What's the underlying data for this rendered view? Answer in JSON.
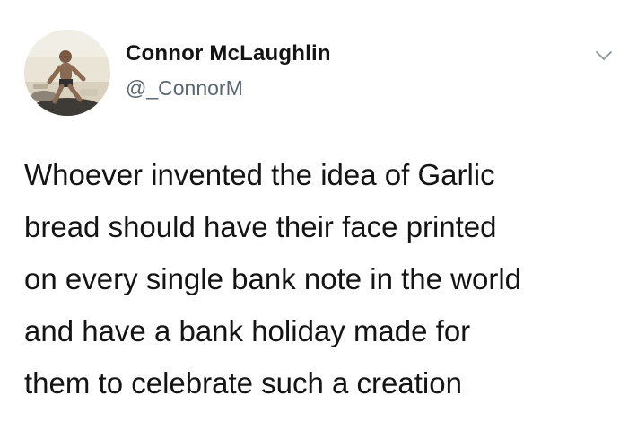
{
  "tweet": {
    "author_name": "Connor McLaughlin",
    "author_handle": "@_ConnorM",
    "avatar_icon": "profile-photo-avatar",
    "menu_icon": "chevron-down-icon",
    "text_lines": [
      "Whoever invented the idea of Garlic",
      "bread should have their face printed",
      "on every single bank note in the world",
      "and have a bank holiday made for",
      "them to celebrate such a creation"
    ]
  }
}
